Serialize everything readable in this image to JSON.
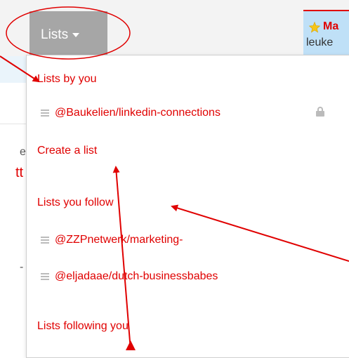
{
  "header": {
    "lists_button": {
      "label": "Lists"
    }
  },
  "background_fragments": {
    "top_right_title": "Ma",
    "top_right_text": "leuke",
    "left_char_1": "e",
    "left_char_2": "tt",
    "left_char_3": "-"
  },
  "dropdown": {
    "sections": {
      "lists_by_you": "Lists by you",
      "create_list": "Create a list",
      "lists_you_follow": "Lists you follow",
      "lists_following_you": "Lists following you"
    },
    "own_lists": [
      {
        "name": "@Baukelien/linkedin-connections",
        "private": true
      }
    ],
    "followed_lists": [
      {
        "name": "@ZZPnetwerk/marketing-"
      },
      {
        "name": "@eljadaae/dutch-businessbabes"
      }
    ]
  },
  "colors": {
    "link_red": "#e00000",
    "button_gray": "#a6a6a6",
    "annotation_red": "#e00000",
    "highlight_blue": "#bfe0f7"
  },
  "icons": [
    "star-icon",
    "list-icon",
    "lock-icon",
    "caret-down-icon"
  ]
}
